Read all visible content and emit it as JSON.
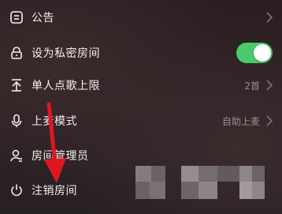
{
  "menu": {
    "items": [
      {
        "label": "公告",
        "icon": "announcement-icon"
      },
      {
        "label": "设为私密房间",
        "icon": "lock-icon",
        "toggle_on": true
      },
      {
        "label": "单人点歌上限",
        "icon": "song-limit-icon",
        "value": "2首"
      },
      {
        "label": "上麦模式",
        "icon": "microphone-icon",
        "value": "自助上麦"
      },
      {
        "label": "房间管理员",
        "icon": "admin-user-icon"
      },
      {
        "label": "注销房间",
        "icon": "power-icon"
      }
    ]
  },
  "colors": {
    "toggle_on": "#4cc96a",
    "annotation_arrow": "#e0161f"
  }
}
